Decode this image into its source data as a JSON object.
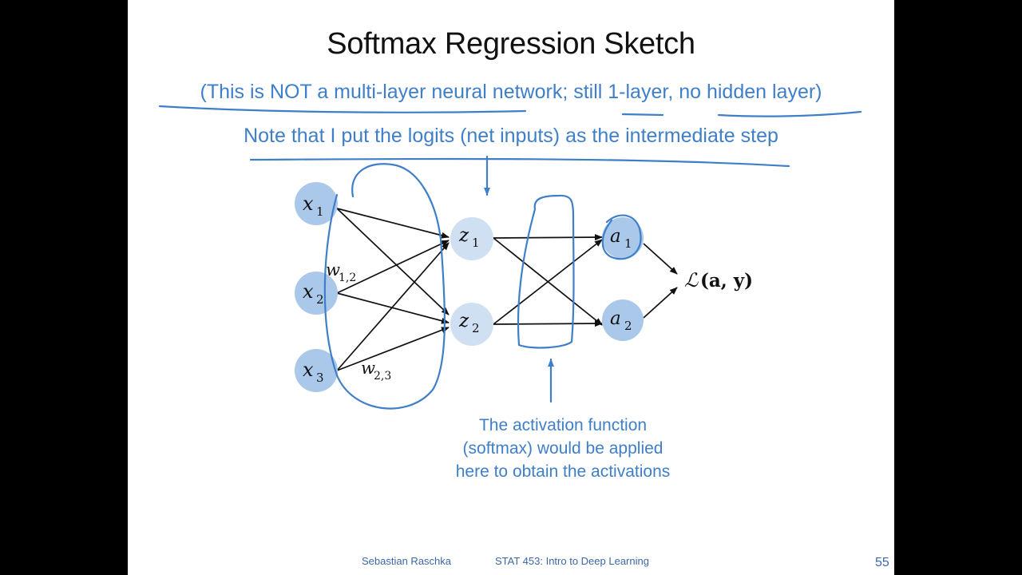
{
  "slide": {
    "title": "Softmax Regression Sketch",
    "note_1": "(This is NOT a multi-layer neural network; still 1-layer, no hidden layer)",
    "note_2": "Note that I put the logits (net inputs) as the intermediate step",
    "activation_note": [
      "The activation function",
      "(softmax) would be applied",
      "here to obtain the activations"
    ],
    "footer_author": "Sebastian Raschka",
    "footer_course": "STAT 453: Intro to Deep Learning",
    "page_number": "55"
  },
  "diagram": {
    "inputs": [
      {
        "base": "x",
        "sub": "1"
      },
      {
        "base": "x",
        "sub": "2"
      },
      {
        "base": "x",
        "sub": "3"
      }
    ],
    "logits": [
      {
        "base": "z",
        "sub": "1"
      },
      {
        "base": "z",
        "sub": "2"
      }
    ],
    "activations": [
      {
        "base": "a",
        "sub": "1"
      },
      {
        "base": "a",
        "sub": "2"
      }
    ],
    "weight_labels": [
      {
        "base": "w",
        "sub": "1,2"
      },
      {
        "base": "w",
        "sub": "2,3"
      }
    ],
    "loss": {
      "script": "ℒ",
      "args": "(a, y)"
    },
    "colors": {
      "input_node": "#a9c8ea",
      "logit_node": "#cfe0f2",
      "activation_node": "#a9c8ea",
      "annotation": "#3f7fc8",
      "arrow": "#111111"
    }
  }
}
